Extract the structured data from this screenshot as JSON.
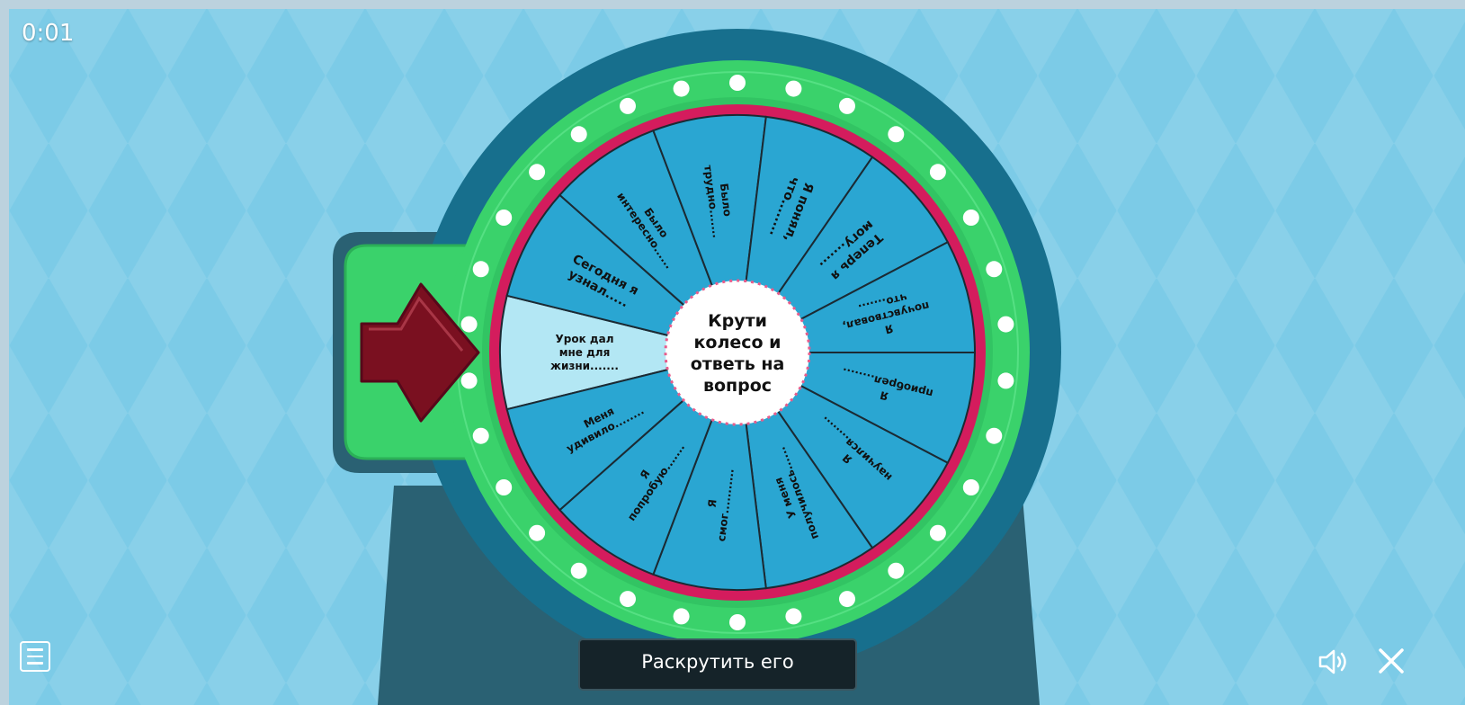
{
  "timer": "0:01",
  "wheel": {
    "center_text": [
      "Крути",
      "колесо и",
      "ответь на",
      "вопрос"
    ],
    "segments": [
      {
        "lines": [
          "Урок дал",
          "мне для",
          "жизни......."
        ]
      },
      {
        "lines": [
          "Сегодня я",
          "узнал....."
        ]
      },
      {
        "lines": [
          "Было",
          "интересно......"
        ]
      },
      {
        "lines": [
          "Было",
          "трудно......."
        ]
      },
      {
        "lines": [
          "Я понял,",
          "что........"
        ]
      },
      {
        "lines": [
          "Теперь я",
          "могу......."
        ]
      },
      {
        "lines": [
          "Я",
          "почувствовал,",
          "что......."
        ]
      },
      {
        "lines": [
          "Я",
          "приобрел........"
        ]
      },
      {
        "lines": [
          "Я",
          "научился........"
        ]
      },
      {
        "lines": [
          "У меня",
          "получилось......"
        ]
      },
      {
        "lines": [
          "Я",
          "смог..........."
        ]
      },
      {
        "lines": [
          "Я",
          "попробую......."
        ]
      },
      {
        "lines": [
          "Меня",
          "удивило........"
        ]
      }
    ],
    "highlighted_segment": 0,
    "colors": {
      "segment": "#2aa6d2",
      "segment_highlight": "#b3e7f4",
      "rim": "#d41c5d",
      "ring": "#3ad26b",
      "frame": "#176f8d",
      "pointer": "#7a1020",
      "stand": "#2a6173"
    }
  },
  "controls": {
    "spin_label": "Раскрутить его",
    "menu_icon": "hamburger-menu-icon",
    "sound_icon": "speaker-icon",
    "close_icon": "close-icon"
  }
}
